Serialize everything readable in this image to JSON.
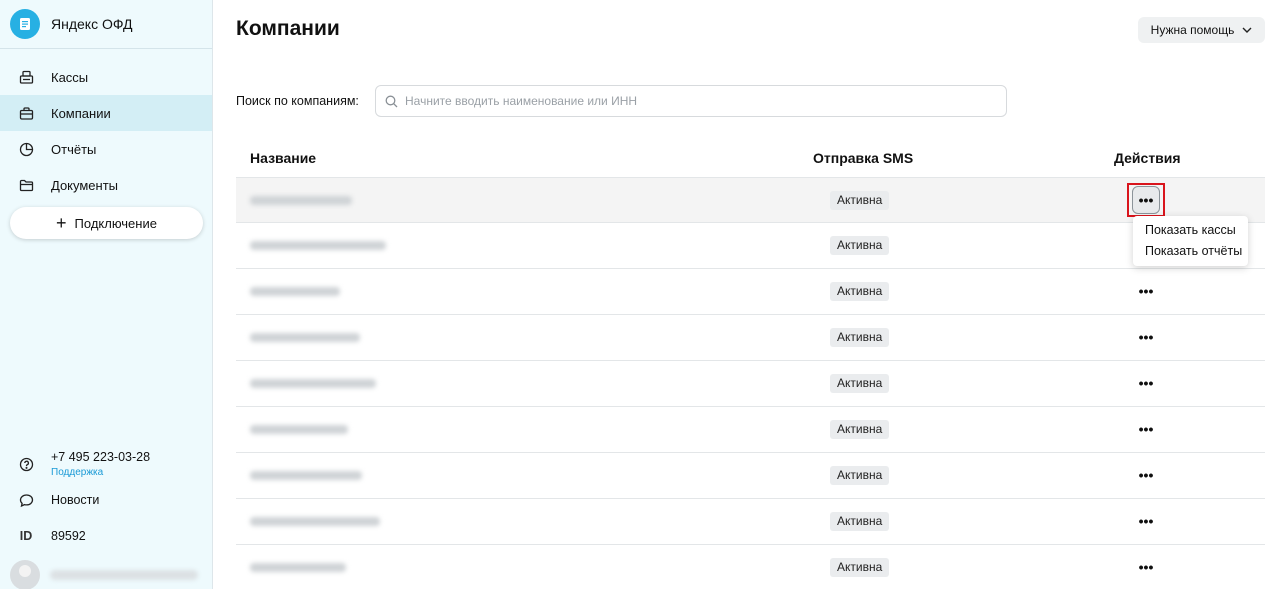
{
  "sidebar": {
    "brand": "Яндекс ОФД",
    "items": [
      {
        "label": "Кассы",
        "icon": "cash-register-icon",
        "active": false
      },
      {
        "label": "Компании",
        "icon": "briefcase-icon",
        "active": true
      },
      {
        "label": "Отчёты",
        "icon": "pie-chart-icon",
        "active": false
      },
      {
        "label": "Документы",
        "icon": "folder-icon",
        "active": false
      }
    ],
    "connect_label": "Подключение",
    "phone": "+7 495 223-03-28",
    "support_label": "Поддержка",
    "news_label": "Новости",
    "id_label": "ID",
    "id_value": "89592"
  },
  "header": {
    "title": "Компании",
    "help_label": "Нужна помощь"
  },
  "search": {
    "label": "Поиск по компаниям:",
    "placeholder": "Начните вводить наименование или ИНН"
  },
  "table": {
    "columns": [
      "Название",
      "Отправка SMS",
      "Действия"
    ],
    "rows": [
      {
        "sms_status": "Активна"
      },
      {
        "sms_status": "Активна"
      },
      {
        "sms_status": "Активна"
      },
      {
        "sms_status": "Активна"
      },
      {
        "sms_status": "Активна"
      },
      {
        "sms_status": "Активна"
      },
      {
        "sms_status": "Активна"
      },
      {
        "sms_status": "Активна"
      },
      {
        "sms_status": "Активна"
      }
    ],
    "actions_glyph": "•••"
  },
  "actions_menu": {
    "items": [
      "Показать кассы",
      "Показать отчёты"
    ]
  },
  "colors": {
    "accent": "#27b0e3",
    "sidebar_bg": "#eefafd",
    "active_item_bg": "#d3eef5",
    "focus_outline": "#d9141c"
  }
}
